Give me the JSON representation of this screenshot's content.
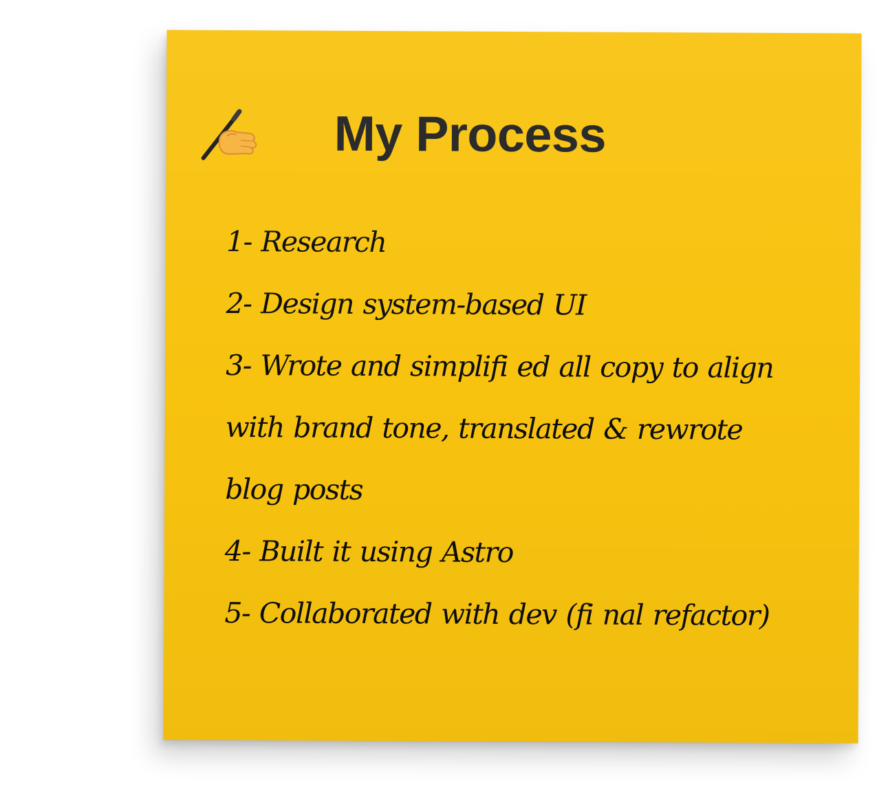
{
  "note": {
    "background": "#f8c30f",
    "icon": "writing-hand-icon",
    "title": "My Process",
    "steps": [
      "1- Research",
      "2- Design system-based UI",
      "3- Wrote and simplifi ed all copy to align with brand tone, translated & rewrote blog posts",
      "4- Built it using Astro",
      "5- Collaborated with dev (fi nal refactor)"
    ]
  }
}
